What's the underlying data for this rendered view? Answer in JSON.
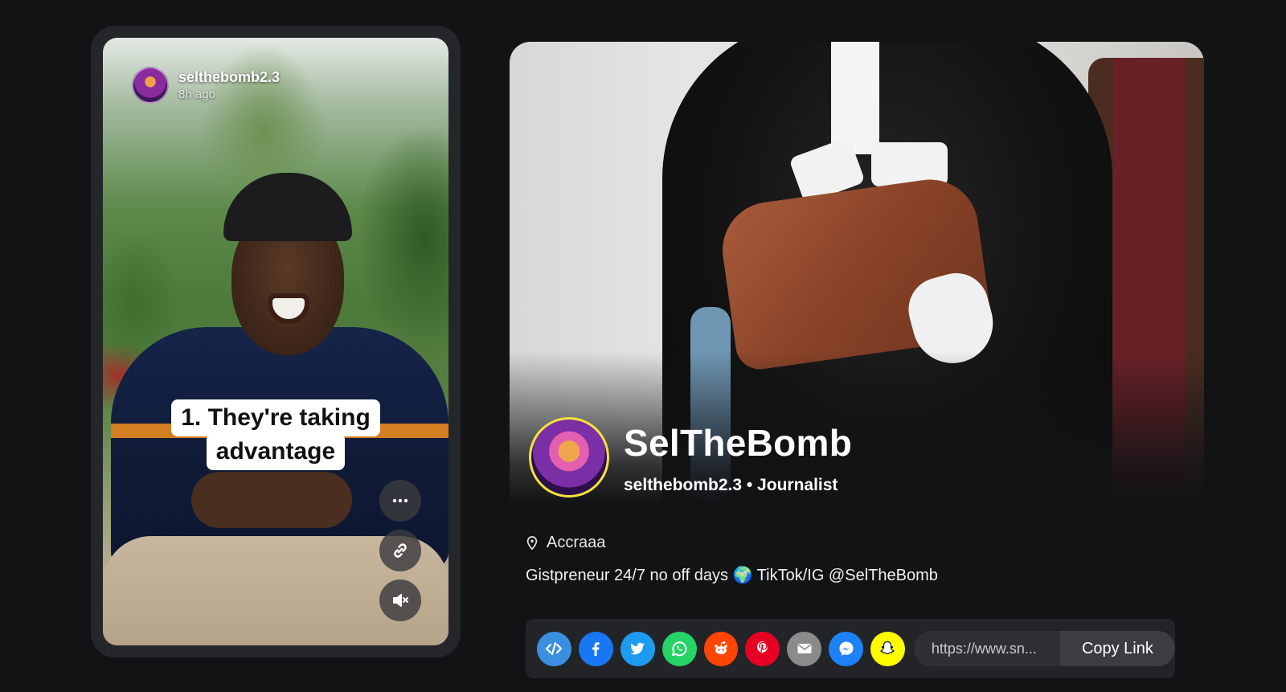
{
  "story": {
    "username": "selthebomb2.3",
    "time": "8h ago",
    "caption_line1": "1. They're taking",
    "caption_line2": "advantage",
    "buttons": [
      "more-icon",
      "link-icon",
      "mute-icon"
    ]
  },
  "profile": {
    "display_name": "SelTheBomb",
    "subtitle": "selthebomb2.3 • Journalist",
    "location": "Accraaa",
    "bio": "Gistpreneur 24/7 no off days 🌍 TikTok/IG @SelTheBomb"
  },
  "share": {
    "buttons": [
      {
        "name": "embed",
        "color": "#3a8fe0"
      },
      {
        "name": "facebook",
        "color": "#1877f2"
      },
      {
        "name": "twitter",
        "color": "#1d9bf0"
      },
      {
        "name": "whatsapp",
        "color": "#25d366"
      },
      {
        "name": "reddit",
        "color": "#ff4500"
      },
      {
        "name": "pinterest",
        "color": "#e60023"
      },
      {
        "name": "email",
        "color": "#8b8b8b"
      },
      {
        "name": "messenger",
        "color": "#1e82f7"
      },
      {
        "name": "snapchat",
        "color": "#fffc00"
      }
    ],
    "link_value": "https://www.sn...",
    "copy_label": "Copy Link"
  }
}
